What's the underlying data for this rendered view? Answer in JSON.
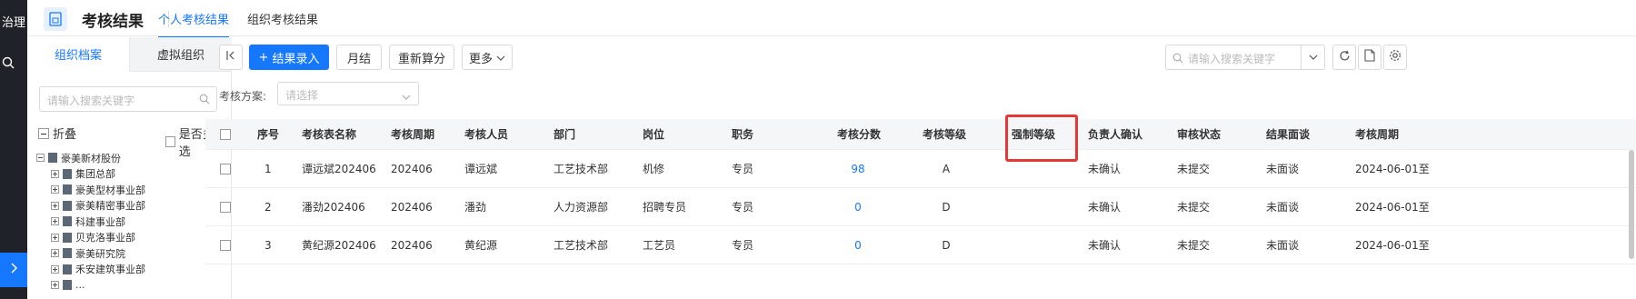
{
  "rail": {
    "title": "治理",
    "icons": [
      "search-icon",
      "chevron-right-icon"
    ]
  },
  "header": {
    "app_title": "考核结果",
    "tabs": [
      {
        "label": "个人考核结果",
        "active": true
      },
      {
        "label": "组织考核结果",
        "active": false
      }
    ]
  },
  "left": {
    "tabs": [
      {
        "label": "组织档案",
        "active": true
      },
      {
        "label": "虚拟组织",
        "active": false
      }
    ],
    "search_placeholder": "请输入搜索关键字",
    "fold_label": "折叠",
    "multi_label": "是否多选",
    "root": "豪美新材股份",
    "children": [
      "集团总部",
      "豪美型材事业部",
      "豪美精密事业部",
      "科建事业部",
      "贝克洛事业部",
      "豪美研究院",
      "禾安建筑事业部",
      "..."
    ]
  },
  "toolbar": {
    "add_label": "结果录入",
    "month_label": "月结",
    "recalc_label": "重新算分",
    "more_label": "更多",
    "search_placeholder": "请输入搜索关键字"
  },
  "filter": {
    "label": "考核方案:",
    "placeholder": "请选择"
  },
  "table": {
    "headers": [
      "序号",
      "考核表名称",
      "考核周期",
      "考核人员",
      "部门",
      "岗位",
      "职务",
      "考核分数",
      "考核等级",
      "强制等级",
      "负责人确认",
      "审核状态",
      "结果面谈",
      "考核周期"
    ],
    "rows": [
      [
        "1",
        "谭远斌202406",
        "202406",
        "谭远斌",
        "工艺技术部",
        "机修",
        "专员",
        "98",
        "A",
        "",
        "未确认",
        "未提交",
        "未面谈",
        "2024-06-01至"
      ],
      [
        "2",
        "潘劲202406",
        "202406",
        "潘劲",
        "人力资源部",
        "招聘专员",
        "专员",
        "0",
        "D",
        "",
        "未确认",
        "未提交",
        "未面谈",
        "2024-06-01至"
      ],
      [
        "3",
        "黄纪源202406",
        "202406",
        "黄纪源",
        "工艺技术部",
        "工艺员",
        "专员",
        "0",
        "D",
        "",
        "未确认",
        "未提交",
        "未面谈",
        "2024-06-01至"
      ]
    ]
  },
  "colors": {
    "accent": "#1677ff",
    "highlight": "#e53935",
    "rail": "#1f2329"
  }
}
